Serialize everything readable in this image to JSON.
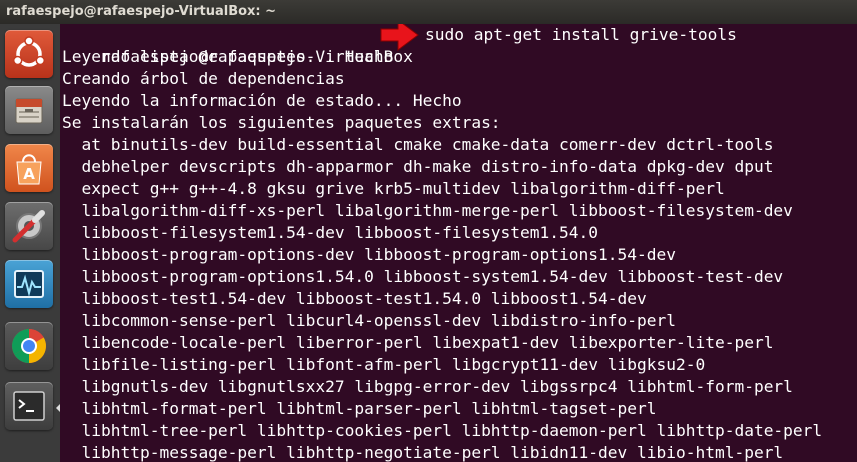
{
  "window": {
    "title": "rafaespejo@rafaespejo-VirtualBox: ~"
  },
  "launcher": {
    "items": [
      {
        "name": "ubuntu-dash-icon"
      },
      {
        "name": "files-icon"
      },
      {
        "name": "software-center-icon"
      },
      {
        "name": "system-settings-icon"
      },
      {
        "name": "system-monitor-icon"
      },
      {
        "name": "chrome-icon"
      },
      {
        "name": "terminal-icon"
      }
    ]
  },
  "terminal": {
    "prompt": "rafaespejo@rafaespejo-VirtualBox",
    "command": "sudo apt-get install grive-tools",
    "arrow_color": "#e8141b",
    "lines": [
      "Leyendo lista de paquetes... Hecho",
      "Creando árbol de dependencias",
      "Leyendo la información de estado... Hecho",
      "Se instalarán los siguientes paquetes extras:",
      "  at binutils-dev build-essential cmake cmake-data comerr-dev dctrl-tools",
      "  debhelper devscripts dh-apparmor dh-make distro-info-data dpkg-dev dput",
      "  expect g++ g++-4.8 gksu grive krb5-multidev libalgorithm-diff-perl",
      "  libalgorithm-diff-xs-perl libalgorithm-merge-perl libboost-filesystem-dev",
      "  libboost-filesystem1.54-dev libboost-filesystem1.54.0",
      "  libboost-program-options-dev libboost-program-options1.54-dev",
      "  libboost-program-options1.54.0 libboost-system1.54-dev libboost-test-dev",
      "  libboost-test1.54-dev libboost-test1.54.0 libboost1.54-dev",
      "  libcommon-sense-perl libcurl4-openssl-dev libdistro-info-perl",
      "  libencode-locale-perl liberror-perl libexpat1-dev libexporter-lite-perl",
      "  libfile-listing-perl libfont-afm-perl libgcrypt11-dev libgksu2-0",
      "  libgnutls-dev libgnutlsxx27 libgpg-error-dev libgssrpc4 libhtml-form-perl",
      "  libhtml-format-perl libhtml-parser-perl libhtml-tagset-perl",
      "  libhtml-tree-perl libhttp-cookies-perl libhttp-daemon-perl libhttp-date-perl",
      "  libhttp-message-perl libhttp-negotiate-perl libidn11-dev libio-html-perl"
    ]
  }
}
